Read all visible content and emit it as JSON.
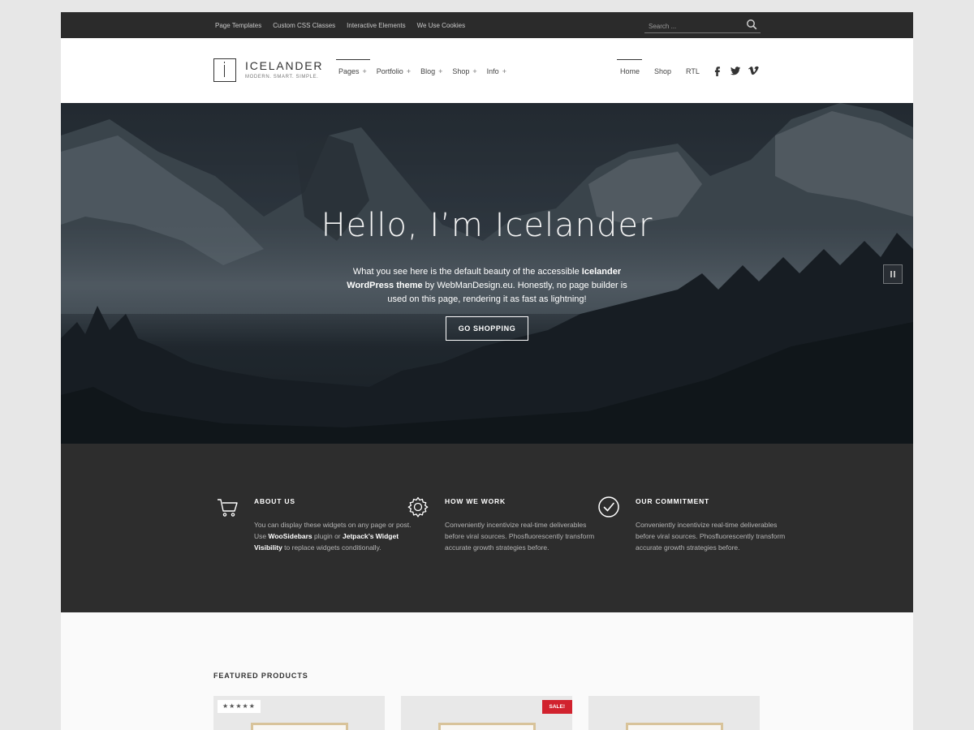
{
  "topbar": {
    "links": [
      "Page Templates",
      "Custom CSS Classes",
      "Interactive Elements",
      "We Use Cookies"
    ],
    "search_placeholder": "Search ...",
    "search_icon": "search-icon"
  },
  "header": {
    "brand_name": "ICELANDER",
    "tagline": "MODERN. SMART. SIMPLE.",
    "main_nav": [
      "Pages",
      "Portfolio",
      "Blog",
      "Shop",
      "Info"
    ],
    "plus": "+",
    "secondary_nav": [
      "Home",
      "Shop",
      "RTL"
    ],
    "social": [
      "facebook-icon",
      "twitter-icon",
      "vimeo-icon"
    ]
  },
  "hero": {
    "title": "Hello, I’m Icelander",
    "desc_1": "What you see here is the default beauty of the accessible ",
    "desc_bold": "Icelander WordPress theme",
    "desc_2": " by WebManDesign.eu. Honestly, no page builder is used on this page, rendering it as fast as lightning!",
    "cta_label": "GO SHOPPING"
  },
  "features": [
    {
      "icon": "cart-icon",
      "title": "ABOUT US",
      "text_1": "You can display these widgets on any page or post. Use ",
      "bold_1": "WooSidebars",
      "text_2": " plugin or ",
      "bold_2": "Jetpack’s Widget Visibility",
      "text_3": " to replace widgets conditionally."
    },
    {
      "icon": "gear-icon",
      "title": "HOW WE WORK",
      "text": "Conveniently incentivize real-time deliverables before viral sources. Phosfluorescently transform accurate growth strategies before."
    },
    {
      "icon": "check-circle-icon",
      "title": "OUR COMMITMENT",
      "text": "Conveniently incentivize real-time deliverables before viral sources. Phosfluorescently transform accurate growth strategies before."
    }
  ],
  "products": {
    "heading": "FEATURED PRODUCTS",
    "stars": "★★★★★",
    "sale_badge": "SALE!"
  }
}
